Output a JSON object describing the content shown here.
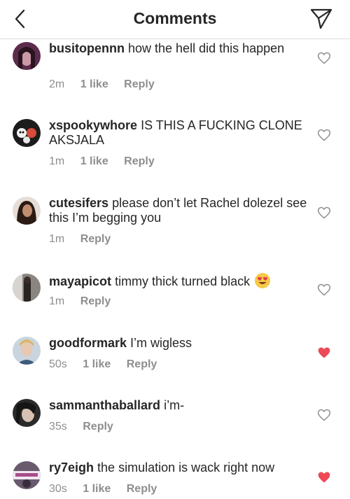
{
  "header": {
    "title": "Comments",
    "back_icon": "chevron-left-icon",
    "send_icon": "paper-plane-icon"
  },
  "colors": {
    "liked_heart": "#ed4956",
    "muted_text": "#8e8e8e",
    "text": "#262626"
  },
  "comments": [
    {
      "username": "busitopennn",
      "text": "how the hell did this happen",
      "time": "2m",
      "likes": "1 like",
      "reply": "Reply",
      "liked": false
    },
    {
      "username": "xspookywhore",
      "text": "IS THIS A FUCKING CLONE AKSJALA",
      "time": "1m",
      "likes": "1 like",
      "reply": "Reply",
      "liked": false
    },
    {
      "username": "cutesifers",
      "text": "please don’t let Rachel dolezel see this I’m begging you",
      "time": "1m",
      "likes": "",
      "reply": "Reply",
      "liked": false
    },
    {
      "username": "mayapicot",
      "text": "timmy thick turned black",
      "emoji": "heart-eyes-emoji",
      "time": "1m",
      "likes": "",
      "reply": "Reply",
      "liked": false
    },
    {
      "username": "goodformark",
      "text": "I’m wigless",
      "time": "50s",
      "likes": "1 like",
      "reply": "Reply",
      "liked": true
    },
    {
      "username": "sammanthaballard",
      "text": "i’m-",
      "time": "35s",
      "likes": "",
      "reply": "Reply",
      "liked": false
    },
    {
      "username": "ry7eigh",
      "text": "the simulation is wack right now",
      "time": "30s",
      "likes": "1 like",
      "reply": "Reply",
      "liked": true
    }
  ]
}
